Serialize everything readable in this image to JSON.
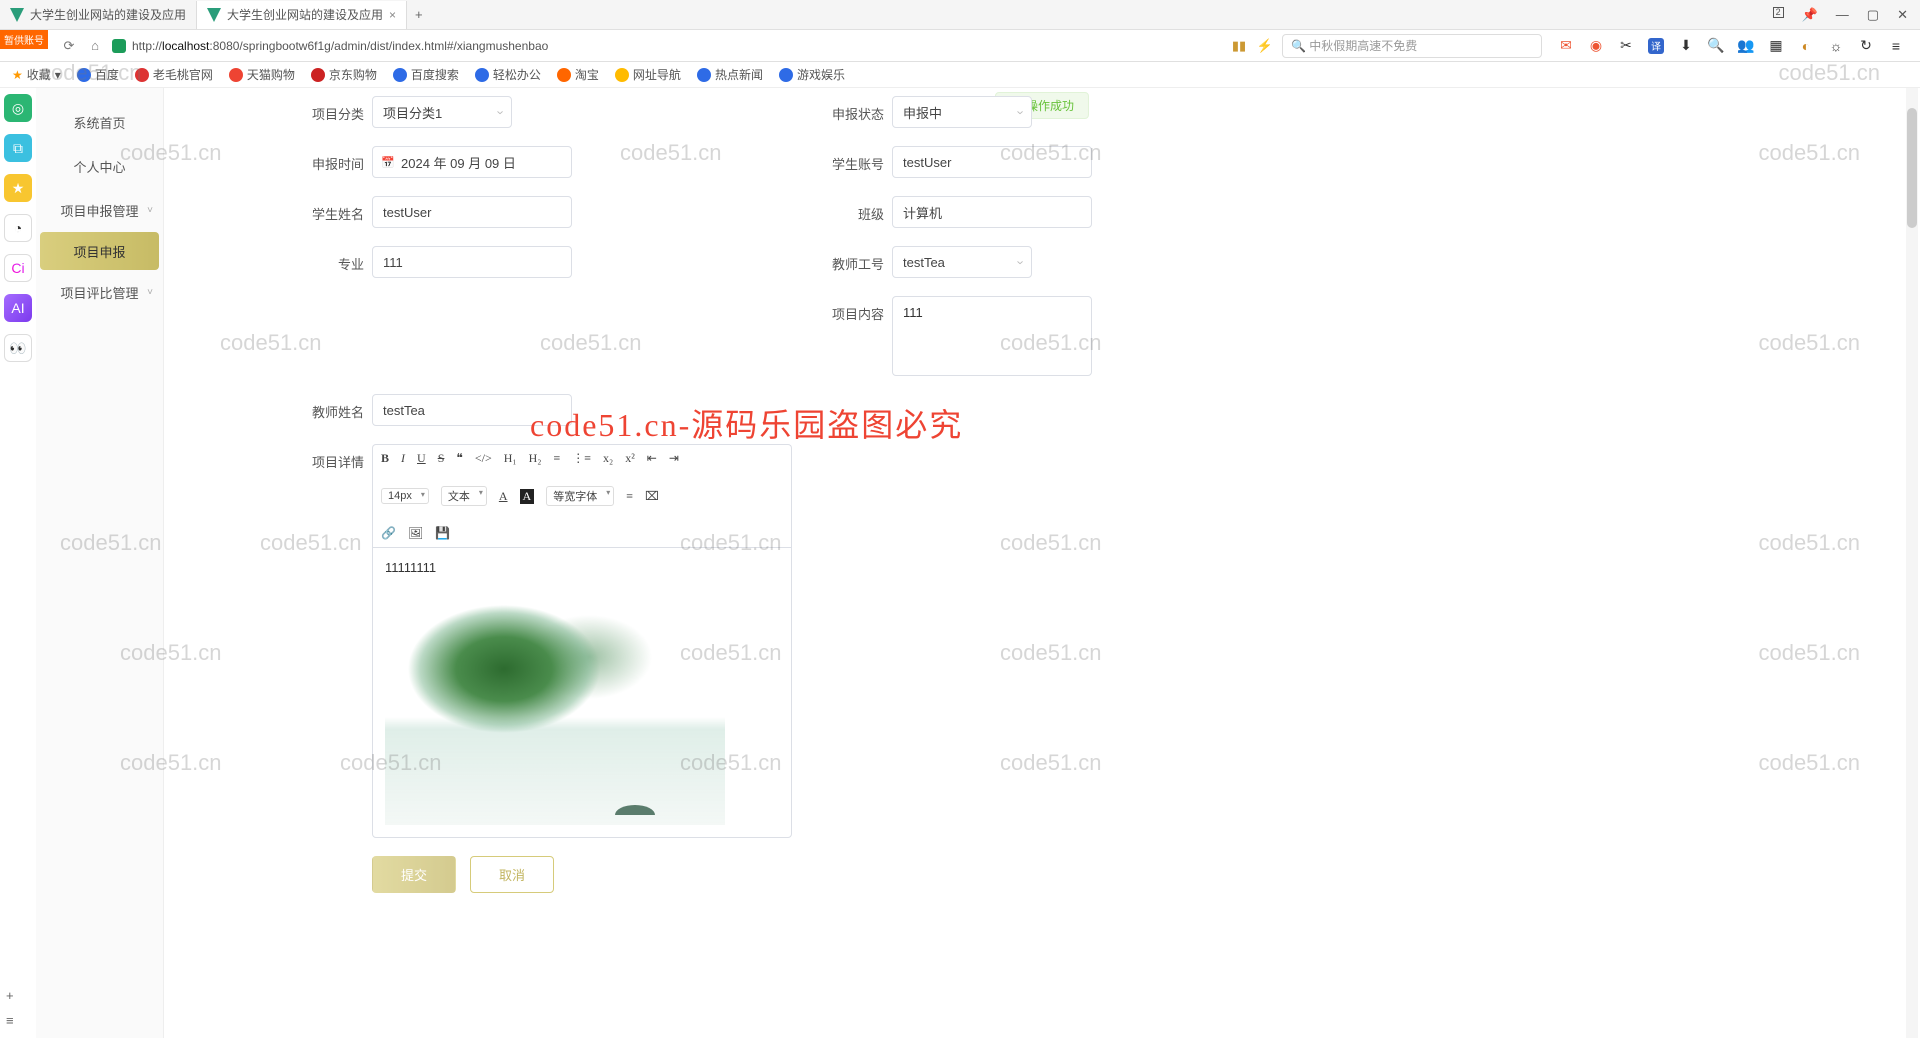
{
  "browser": {
    "tabs": [
      {
        "title": "大学生创业网站的建设及应用"
      },
      {
        "title": "大学生创业网站的建设及应用"
      }
    ],
    "url_prefix": "http://",
    "url_host": "localhost",
    "url_rest": ":8080/springbootw6f1g/admin/dist/index.html#/xiangmushenbao",
    "search_placeholder": "中秋假期高速不免费",
    "win_count": "2"
  },
  "bookmarks": {
    "fav": "收藏",
    "items": [
      "百度",
      "老毛桃官网",
      "天猫购物",
      "京东购物",
      "百度搜索",
      "轻松办公",
      "淘宝",
      "网址导航",
      "热点新闻",
      "游戏娱乐"
    ]
  },
  "badge": "暂供账号",
  "sidebar": {
    "items": [
      {
        "label": "系统首页"
      },
      {
        "label": "个人中心"
      },
      {
        "label": "项目申报管理",
        "expand": true
      },
      {
        "label": "项目申报",
        "sub": true,
        "active": true
      },
      {
        "label": "项目评比管理",
        "expand": true
      }
    ]
  },
  "toast": "操作成功",
  "form": {
    "category_label": "项目分类",
    "category_value": "项目分类1",
    "status_label": "申报状态",
    "status_value": "申报中",
    "apply_time_label": "申报时间",
    "apply_time_value": "2024 年 09 月 09 日",
    "student_account_label": "学生账号",
    "student_account_value": "testUser",
    "student_name_label": "学生姓名",
    "student_name_value": "testUser",
    "class_label": "班级",
    "class_value": "计算机",
    "major_label": "专业",
    "major_value": "111",
    "teacher_id_label": "教师工号",
    "teacher_id_value": "testTea",
    "content_label": "项目内容",
    "content_value": "111",
    "teacher_name_label": "教师姓名",
    "teacher_name_value": "testTea",
    "detail_label": "项目详情",
    "editor_text": "11111111",
    "font_size": "14px",
    "font_style": "文本"
  },
  "buttons": {
    "submit": "提交",
    "cancel": "取消"
  },
  "watermark_text": "code51.cn",
  "watermark_red": "code51.cn-源码乐园盗图必究"
}
